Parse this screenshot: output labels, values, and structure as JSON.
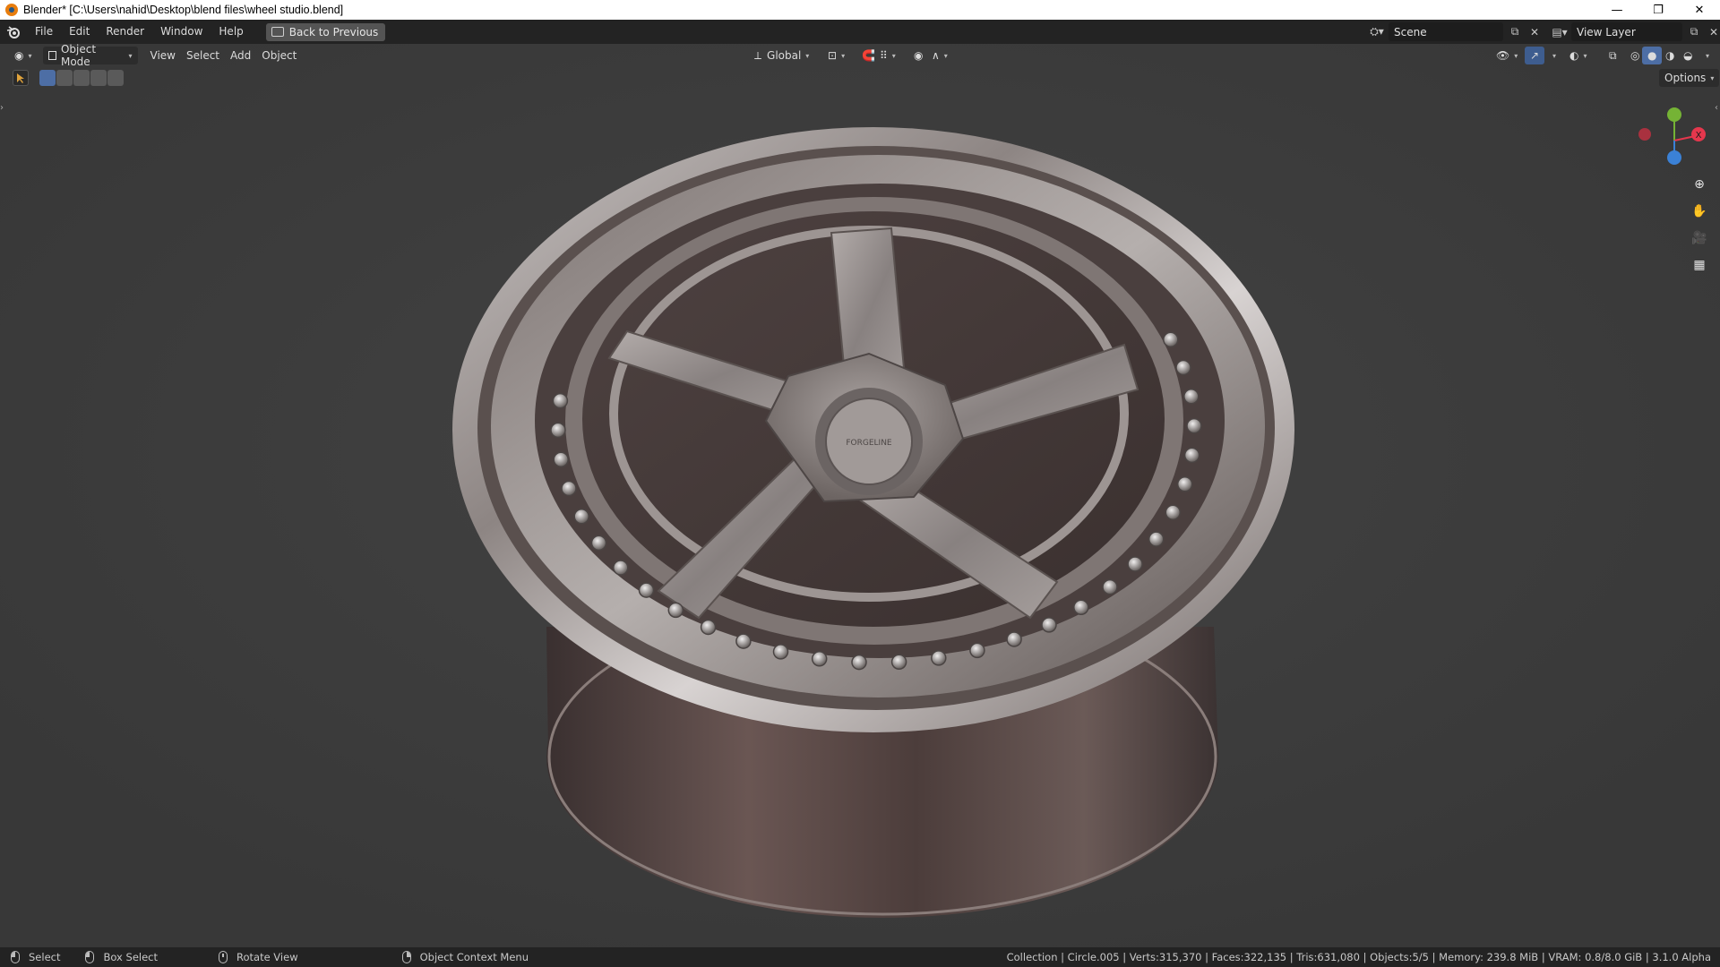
{
  "window": {
    "title": "Blender* [C:\\Users\\nahid\\Desktop\\blend files\\wheel studio.blend]",
    "minimize": "—",
    "restore": "❐",
    "close": "✕"
  },
  "topbar": {
    "menus": [
      "File",
      "Edit",
      "Render",
      "Window",
      "Help"
    ],
    "back_button": "Back to Previous",
    "scene_name": "Scene",
    "view_layer": "View Layer"
  },
  "header": {
    "mode": "Object Mode",
    "menus": [
      "View",
      "Select",
      "Add",
      "Object"
    ],
    "transform_orientation": "Global",
    "options_label": "Options"
  },
  "wheel_logo": "FORGELINE",
  "gizmo": {
    "x_label": "X",
    "y_label": "Y",
    "z_label": "Z"
  },
  "statusbar": {
    "select": "Select",
    "box_select": "Box Select",
    "rotate_view": "Rotate View",
    "context_menu": "Object Context Menu",
    "stats": "Collection | Circle.005 | Verts:315,370 | Faces:322,135 | Tris:631,080 | Objects:5/5 | Memory: 239.8 MiB | VRAM: 0.8/8.0 GiB | 3.1.0 Alpha"
  },
  "colors": {
    "viewport_bg": "#3d3d3d",
    "header_bg": "#232323",
    "x_axis": "#e5374d",
    "y_axis": "#75b335",
    "z_axis": "#3b81d6"
  }
}
